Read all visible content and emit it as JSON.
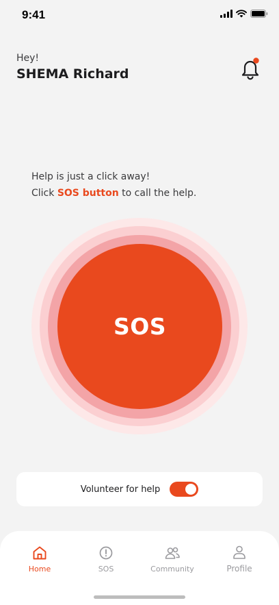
{
  "status_bar": {
    "time": "9:41",
    "icons": [
      "cellular-signal-icon",
      "wifi-icon",
      "battery-icon"
    ]
  },
  "header": {
    "greeting": "Hey!",
    "user_name": "SHEMA Richard",
    "notification_icon": "bell-icon",
    "has_unread_badge": true
  },
  "help": {
    "line1": "Help is just a click away!",
    "line2_prefix": "Click ",
    "line2_accent": "SOS button",
    "line2_suffix": " to call the help."
  },
  "sos_button": {
    "label": "SOS"
  },
  "volunteer": {
    "label": "Volunteer for help",
    "enabled": true
  },
  "bottom_nav": {
    "items": [
      {
        "label": "Home",
        "icon": "home-icon",
        "active": true
      },
      {
        "label": "SOS",
        "icon": "alert-circle-icon",
        "active": false
      },
      {
        "label": "Community",
        "icon": "users-icon",
        "active": false
      },
      {
        "label": "Profile",
        "icon": "user-icon",
        "active": false
      }
    ]
  },
  "colors": {
    "accent": "#e9491e",
    "background": "#f3f3f3",
    "ring_outer": "#fde8e8",
    "ring_middle": "#fbcfd1",
    "ring_inner": "#f3a4a7",
    "inactive_nav": "#9a9a9e"
  }
}
